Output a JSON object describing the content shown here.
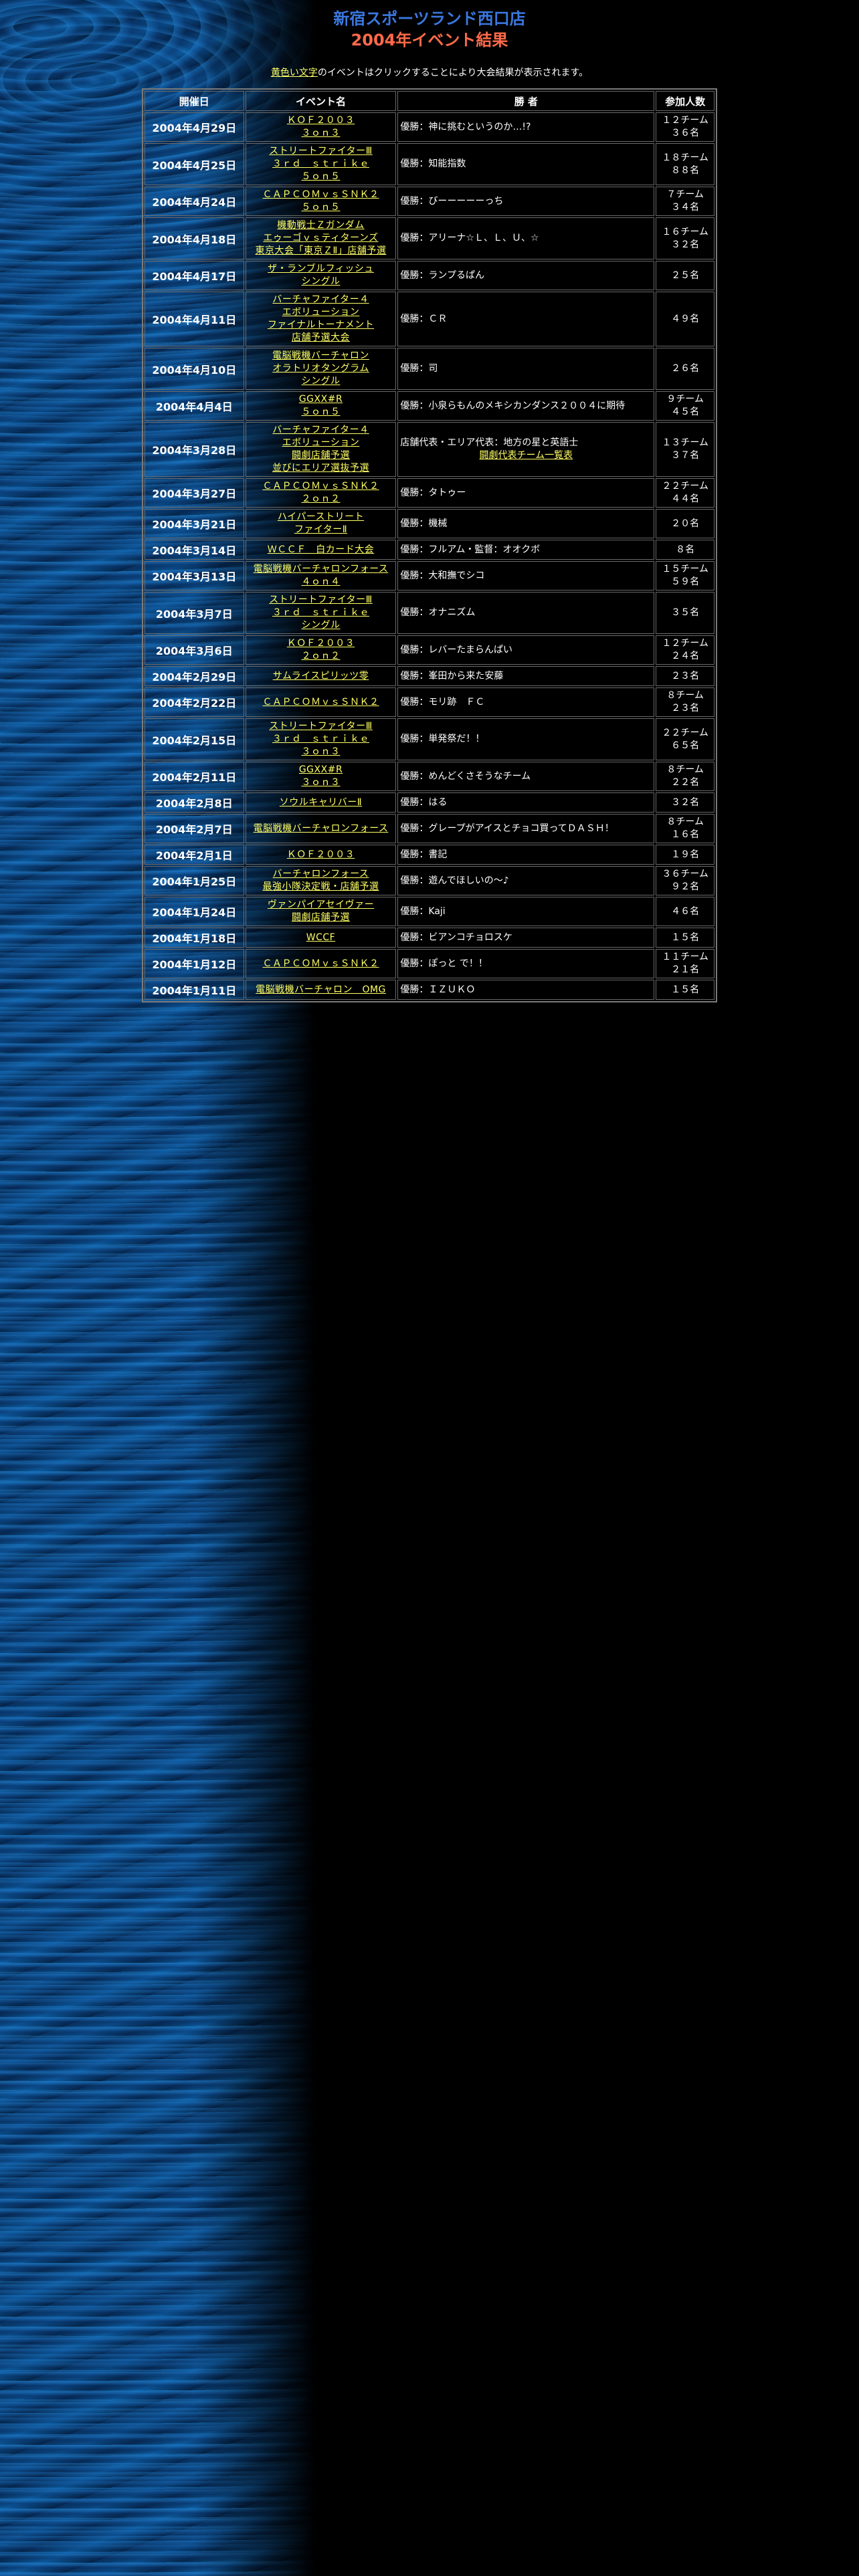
{
  "header": {
    "title_line1": "新宿スポーツランド西口店",
    "title_line2": "2004年イベント結果"
  },
  "note": {
    "highlight": "黄色い文字",
    "text": "のイベントはクリックすることにより大会結果が表示されます。"
  },
  "colors": {
    "title_blue": "#3a78e0",
    "title_red": "#ff6a4a",
    "link_yellow": "#ffff66",
    "background": "#000000"
  },
  "table": {
    "headers": [
      "開催日",
      "イベント名",
      "勝 者",
      "参加人数"
    ],
    "rows": [
      {
        "date": "2004年4月29日",
        "event": [
          "ＫＯＦ２００３",
          "３ｏｎ３"
        ],
        "winner": [
          "優勝：神に挑むというのか…!?"
        ],
        "count": [
          "１２チーム",
          "３６名"
        ]
      },
      {
        "date": "2004年4月25日",
        "event": [
          "ストリートファイターⅢ",
          "３ｒｄ　ｓｔｒｉｋｅ",
          "５ｏｎ５"
        ],
        "winner": [
          "優勝：知能指数"
        ],
        "count": [
          "１８チーム",
          "８８名"
        ]
      },
      {
        "date": "2004年4月24日",
        "event": [
          "ＣＡＰＣＯＭｖｓＳＮＫ２",
          "５ｏｎ５"
        ],
        "winner": [
          "優勝：びーーーーーっち"
        ],
        "count": [
          "７チーム",
          "３４名"
        ]
      },
      {
        "date": "2004年4月18日",
        "event": [
          "機動戦士Ｚガンダム",
          "エゥーゴｖｓティターンズ",
          "東京大会「東京ＺⅡ」店舗予選"
        ],
        "winner": [
          "優勝：アリーナ☆Ｌ、Ｌ、Ｕ、☆"
        ],
        "count": [
          "１６チーム",
          "３２名"
        ]
      },
      {
        "date": "2004年4月17日",
        "event": [
          "ザ・ランブルフィッシュ",
          "シングル"
        ],
        "winner": [
          "優勝：ランプるぱん"
        ],
        "count": [
          "２５名"
        ]
      },
      {
        "date": "2004年4月11日",
        "event": [
          "バーチャファイター４",
          "エボリューション",
          "ファイナルトーナメント",
          "店舗予選大会"
        ],
        "winner": [
          "優勝：ＣＲ"
        ],
        "count": [
          "４９名"
        ]
      },
      {
        "date": "2004年4月10日",
        "event": [
          "電脳戦機バーチャロン",
          "オラトリオタングラム",
          "シングル"
        ],
        "winner": [
          "優勝：司"
        ],
        "count": [
          "２６名"
        ]
      },
      {
        "date": "2004年4月4日",
        "event": [
          "GGXX#R",
          "５ｏｎ５"
        ],
        "winner": [
          "優勝：小泉らもんのメキシカンダンス２００４に期待"
        ],
        "count": [
          "９チーム",
          "４５名"
        ]
      },
      {
        "date": "2004年3月28日",
        "event": [
          "バーチャファイター４",
          "エボリューション",
          "闘劇店舗予選",
          "並びにエリア選抜予選"
        ],
        "winner": [
          "店舗代表・エリア代表：地方の星と英語士"
        ],
        "winner_link": "闘劇代表チーム一覧表",
        "count": [
          "１３チーム",
          "３７名"
        ]
      },
      {
        "date": "2004年3月27日",
        "event": [
          "ＣＡＰＣＯＭｖｓＳＮＫ２",
          "２ｏｎ２"
        ],
        "winner": [
          "優勝：タトゥー"
        ],
        "count": [
          "２２チーム",
          "４４名"
        ]
      },
      {
        "date": "2004年3月21日",
        "event": [
          "ハイパーストリート",
          "ファイターⅡ"
        ],
        "winner": [
          "優勝：機械"
        ],
        "count": [
          "２０名"
        ]
      },
      {
        "date": "2004年3月14日",
        "event": [
          "ＷＣＣＦ　白カード大会"
        ],
        "winner": [
          "優勝：フルアム・監督：オオクボ"
        ],
        "count": [
          "８名"
        ]
      },
      {
        "date": "2004年3月13日",
        "event": [
          "電脳戦機バーチャロンフォース",
          "４ｏｎ４"
        ],
        "winner": [
          "優勝：大和撫でシコ"
        ],
        "count": [
          "１５チーム",
          "５９名"
        ]
      },
      {
        "date": "2004年3月7日",
        "event": [
          "ストリートファイターⅢ",
          "３ｒｄ　ｓｔｒｉｋｅ",
          "シングル"
        ],
        "winner": [
          "優勝：オナニズム"
        ],
        "count": [
          "３５名"
        ]
      },
      {
        "date": "2004年3月6日",
        "event": [
          "ＫＯＦ２００３",
          "２ｏｎ２"
        ],
        "winner": [
          "優勝：レバーたまらんぱい"
        ],
        "count": [
          "１２チーム",
          "２４名"
        ]
      },
      {
        "date": "2004年2月29日",
        "event": [
          "サムライスピリッツ零"
        ],
        "winner": [
          "優勝：峯田から来た安藤"
        ],
        "count": [
          "２３名"
        ]
      },
      {
        "date": "2004年2月22日",
        "event": [
          "ＣＡＰＣＯＭｖｓＳＮＫ２"
        ],
        "winner": [
          "優勝：モリ跡　ＦＣ"
        ],
        "count": [
          "８チーム",
          "２３名"
        ]
      },
      {
        "date": "2004年2月15日",
        "event": [
          "ストリートファイターⅢ",
          "３ｒｄ　ｓｔｒｉｋｅ",
          "３ｏｎ３"
        ],
        "winner": [
          "優勝：単発祭だ！！"
        ],
        "count": [
          "２２チーム",
          "６５名"
        ]
      },
      {
        "date": "2004年2月11日",
        "event": [
          "GGXX#R",
          "３ｏｎ３"
        ],
        "winner": [
          "優勝：めんどくさそうなチーム"
        ],
        "count": [
          "８チーム",
          "２２名"
        ]
      },
      {
        "date": "2004年2月8日",
        "event": [
          "ソウルキャリバーⅡ"
        ],
        "winner": [
          "優勝：はる"
        ],
        "count": [
          "３２名"
        ]
      },
      {
        "date": "2004年2月7日",
        "event": [
          "電脳戦機バーチャロンフォース"
        ],
        "winner": [
          "優勝：グレープがアイスとチョコ買ってＤＡＳＨ！"
        ],
        "count": [
          "８チーム",
          "１６名"
        ]
      },
      {
        "date": "2004年2月1日",
        "event": [
          "ＫＯＦ２００３"
        ],
        "winner": [
          "優勝：書記"
        ],
        "count": [
          "１９名"
        ]
      },
      {
        "date": "2004年1月25日",
        "event": [
          "バーチャロンフォース",
          "最強小隊決定戦・店舗予選"
        ],
        "winner": [
          "優勝：遊んでほしいの〜♪"
        ],
        "count": [
          "３６チーム",
          "９２名"
        ]
      },
      {
        "date": "2004年1月24日",
        "event": [
          "ヴァンパイアセイヴァー",
          "闘劇店舗予選"
        ],
        "winner": [
          "優勝：Kaji"
        ],
        "count": [
          "４６名"
        ]
      },
      {
        "date": "2004年1月18日",
        "event": [
          "WCCF"
        ],
        "winner": [
          "優勝：ビアンコチョロスケ"
        ],
        "count": [
          "１５名"
        ]
      },
      {
        "date": "2004年1月12日",
        "event": [
          "ＣＡＰＣＯＭｖｓＳＮＫ２"
        ],
        "winner": [
          "優勝：ぽっと で！！"
        ],
        "count": [
          "１１チーム",
          "２１名"
        ]
      },
      {
        "date": "2004年1月11日",
        "event": [
          "電脳戦機バーチャロン　OMG"
        ],
        "winner": [
          "優勝：ＩＺＵＫＯ"
        ],
        "count": [
          "１５名"
        ]
      }
    ]
  }
}
